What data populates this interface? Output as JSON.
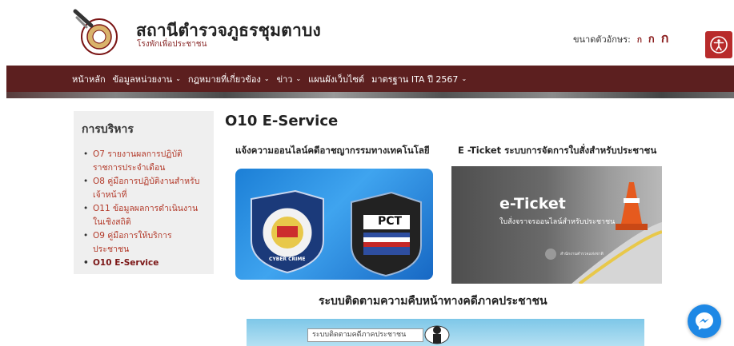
{
  "header": {
    "site_title": "สถานีตำรวจภูธรชุมตาบง",
    "site_subtitle": "โรงพักเพื่อประชาชน",
    "font_size_label": "ขนาดตัวอักษร:",
    "font_size_options": [
      "ก",
      "ก",
      "ก"
    ]
  },
  "nav": {
    "items": [
      {
        "label": "หน้าหลัก",
        "has_dropdown": false
      },
      {
        "label": "ข้อมูลหน่วยงาน",
        "has_dropdown": true
      },
      {
        "label": "กฎหมายที่เกี่ยวข้อง",
        "has_dropdown": true
      },
      {
        "label": "ข่าว",
        "has_dropdown": true
      },
      {
        "label": "แผนผังเว็บไซต์",
        "has_dropdown": false
      },
      {
        "label": "มาตรฐาน ITA ปี 2567",
        "has_dropdown": true
      }
    ],
    "caret": "⌄"
  },
  "sidebar": {
    "title": "การบริหาร",
    "items": [
      {
        "label": "O7 รายงานผลการปฏิบัติราชการประจำเดือน",
        "active": false
      },
      {
        "label": "O8 คู่มือการปฏิบัติงานสำหรับเจ้าหน้าที่",
        "active": false
      },
      {
        "label": "O11 ข้อมูลผลการดำเนินงานในเชิงสถิติ",
        "active": false
      },
      {
        "label": "O9 คู่มือการให้บริการประชาชน",
        "active": false
      },
      {
        "label": "O10 E-Service",
        "active": true
      }
    ]
  },
  "main": {
    "page_title": "O10 E-Service",
    "cards": [
      {
        "title": "แจ้งความออนไลน์คดีอาชญากรรมทางเทคโนโลยี",
        "badge_left_text": "CYBER CRIME",
        "badge_right_text": "PCT"
      },
      {
        "title": "E -Ticket ระบบการจัดการใบสั่งสำหรับประชาชน",
        "banner_heading": "e-Ticket",
        "banner_sub": "ใบสั่งจราจรออนไลน์สำหรับประชาชน",
        "banner_footer": "สำนักงานตำรวจแห่งชาติ"
      }
    ],
    "section_title": "ระบบติดตามความคืบหน้าทางคดีภาคประชาชน",
    "tracker_label": "ระบบติดตามคดีภาคประชาชน"
  },
  "colors": {
    "nav_bg": "#5c1f1f",
    "accent": "#b82b2b",
    "link": "#b33a2a",
    "messenger": "#1e88e5"
  },
  "icons": {
    "accessibility": "accessibility-icon",
    "messenger": "messenger-icon",
    "logo": "police-emblem-logo"
  }
}
